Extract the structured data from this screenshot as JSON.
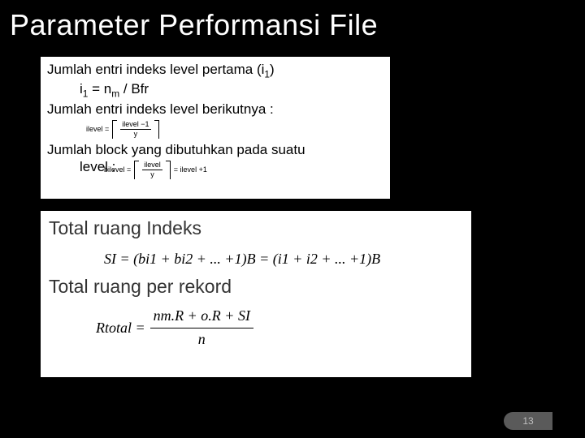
{
  "slide": {
    "title": "Parameter Performansi File",
    "page_number": "13"
  },
  "panel1": {
    "line1_a": "Jumlah entri indeks level pertama (i",
    "line1_sub": "1",
    "line1_b": ")",
    "line2_a": "i",
    "line2_sub": "1",
    "line2_b": " = n",
    "line2_sub2": "m",
    "line2_c": " / Bfr",
    "line3": "Jumlah entri indeks level berikutnya :",
    "eq1_lhs": "ilevel =",
    "eq1_num": "ilevel −1",
    "eq1_den": "y",
    "line4": "Jumlah block yang dibutuhkan pada suatu",
    "line5": "level :",
    "eq2_lhs": "bilevel =",
    "eq2_num": "ilevel",
    "eq2_den": "y",
    "eq2_rhs": "= ilevel +1"
  },
  "panel2": {
    "heading1": "Total ruang Indeks",
    "eq1": "SI = (bi1 + bi2 + ... +1)B = (i1 + i2 + ... +1)B",
    "heading2": "Total ruang per rekord",
    "eq2_lhs": "Rtotal  =",
    "eq2_num": "nm.R + o.R + SI",
    "eq2_den": "n"
  }
}
